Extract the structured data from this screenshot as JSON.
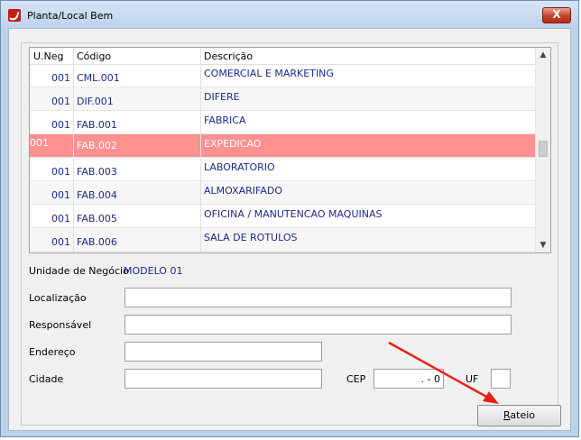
{
  "window": {
    "title": "Planta/Local Bem",
    "close_label": "X"
  },
  "grid": {
    "headers": [
      "U.Neg",
      "Código",
      "Descrição"
    ],
    "rows": [
      {
        "uneg": "001",
        "codigo": "CML.001",
        "descricao": "COMERCIAL E MARKETING"
      },
      {
        "uneg": "001",
        "codigo": "DIF.001",
        "descricao": "DIFERE"
      },
      {
        "uneg": "001",
        "codigo": "FAB.001",
        "descricao": "FABRICA"
      },
      {
        "uneg": "001",
        "codigo": "FAB.002",
        "descricao": "EXPEDICAO"
      },
      {
        "uneg": "001",
        "codigo": "FAB.003",
        "descricao": "LABORATORIO"
      },
      {
        "uneg": "001",
        "codigo": "FAB.004",
        "descricao": "ALMOXARIFADO"
      },
      {
        "uneg": "001",
        "codigo": "FAB.005",
        "descricao": "OFICINA / MANUTENCAO MAQUINAS"
      },
      {
        "uneg": "001",
        "codigo": "FAB.006",
        "descricao": "SALA DE ROTULOS"
      }
    ],
    "selected_index": 3,
    "selected_color": "#ff9090",
    "text_color": "#1b2a8a"
  },
  "form": {
    "unidade_label": "Unidade de Negócio",
    "unidade_value": "MODELO 01",
    "localizacao_label": "Localização",
    "localizacao_value": "",
    "responsavel_label": "Responsável",
    "responsavel_value": "",
    "endereco_label": "Endereço",
    "endereco_value": "",
    "cidade_label": "Cidade",
    "cidade_value": "",
    "cep_label": "CEP",
    "cep_value": ".   - 0",
    "uf_label": "UF",
    "uf_value": ""
  },
  "actions": {
    "rateio_first": "R",
    "rateio_rest": "ateio"
  },
  "annotation": {
    "arrow_color": "#e8201a"
  },
  "icons": {
    "app": "app-logo-icon",
    "scroll_up": "chevron-up-icon",
    "scroll_down": "chevron-down-icon"
  }
}
